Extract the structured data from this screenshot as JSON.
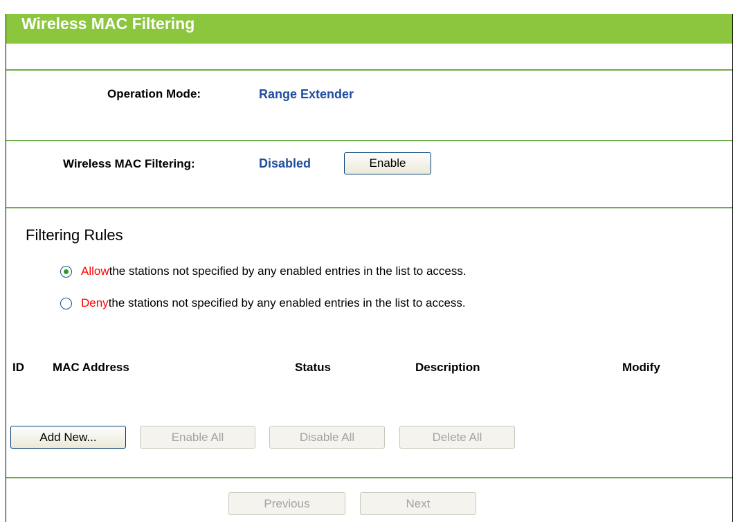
{
  "page": {
    "title": "Wireless MAC Filtering"
  },
  "operation": {
    "label": "Operation Mode:",
    "value": "Range Extender"
  },
  "filtering": {
    "label": "Wireless MAC Filtering:",
    "status": "Disabled",
    "toggle_label": "Enable"
  },
  "rules": {
    "title": "Filtering Rules",
    "allow": {
      "keyword": "Allow",
      "text": " the stations not specified by any enabled entries in the list to access.",
      "checked": true
    },
    "deny": {
      "keyword": "Deny",
      "text": " the stations not specified by any enabled entries in the list to access.",
      "checked": false
    }
  },
  "table": {
    "columns": [
      "ID",
      "MAC Address",
      "Status",
      "Description",
      "Modify"
    ]
  },
  "actions": {
    "add_new": "Add New...",
    "enable_all": "Enable All",
    "disable_all": "Disable All",
    "delete_all": "Delete All"
  },
  "nav": {
    "previous": "Previous",
    "next": "Next"
  },
  "colors": {
    "header_green": "#8cc63f",
    "rule_green": "#6cae4c",
    "value_blue": "#1f4e9e",
    "keyword_red": "#ff0000"
  }
}
